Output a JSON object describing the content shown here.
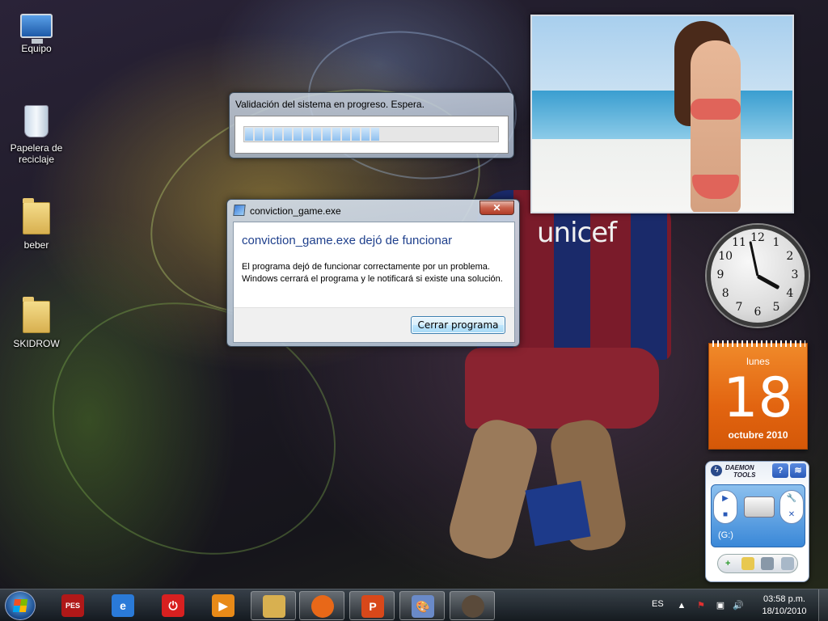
{
  "desktop": {
    "icons": [
      {
        "label": "Equipo",
        "icon": "computer-icon"
      },
      {
        "label": "Papelera de reciclaje",
        "icon": "recycle-bin-icon"
      },
      {
        "label": "beber",
        "icon": "folder-icon"
      },
      {
        "label": "SKIDROW",
        "icon": "folder-icon"
      }
    ],
    "wallpaper_shirt_text": "unicef"
  },
  "progress_dialog": {
    "caption": "Validación del sistema en progreso. Espera.",
    "progress_fraction": 0.55
  },
  "crash_dialog": {
    "title": "conviction_game.exe",
    "close_label": "✕",
    "heading": "conviction_game.exe dejó de funcionar",
    "message": "El programa dejó de funcionar correctamente por un problema. Windows cerrará el programa y le notificará si existe una solución.",
    "button_label": "Cerrar programa"
  },
  "clock_gadget": {
    "numbers": [
      "12",
      "1",
      "2",
      "3",
      "4",
      "5",
      "6",
      "7",
      "8",
      "9",
      "10",
      "11"
    ],
    "time": "03:58"
  },
  "calendar_gadget": {
    "weekday": "lunes",
    "day": "18",
    "month_year": "octubre 2010"
  },
  "daemon_tools": {
    "brand_line1": "DAEMON",
    "brand_line2": "TOOLS",
    "help_label": "?",
    "drive_label": "(G:)"
  },
  "taskbar": {
    "apps": [
      {
        "name": "pes-app-icon",
        "glyph": "PES",
        "color": "#b01818"
      },
      {
        "name": "internet-explorer-icon",
        "glyph": "e",
        "color": "#2a7ad8"
      },
      {
        "name": "power-app-icon",
        "glyph": "⏻",
        "color": "#d82020"
      },
      {
        "name": "media-player-icon",
        "glyph": "▶",
        "color": "#e88a18"
      },
      {
        "name": "explorer-folder-icon",
        "glyph": "",
        "color": "#d8b050"
      },
      {
        "name": "firefox-icon",
        "glyph": "",
        "color": "#e86818"
      },
      {
        "name": "powerpoint-icon",
        "glyph": "P",
        "color": "#d8481a"
      },
      {
        "name": "paint-icon",
        "glyph": "🎨",
        "color": "#6a8ac8"
      },
      {
        "name": "conviction-game-icon",
        "glyph": "",
        "color": "#5a4a3a"
      }
    ],
    "language": "ES",
    "time": "03:58 p.m.",
    "date": "18/10/2010"
  }
}
